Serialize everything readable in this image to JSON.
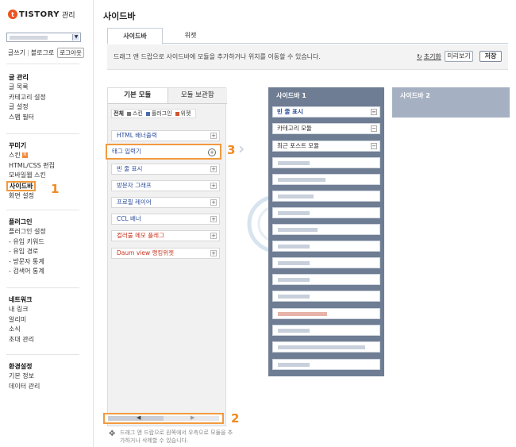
{
  "brand": {
    "logo": "TISTORY",
    "admin": "관리"
  },
  "quick_links": {
    "write": "글쓰기",
    "blog": "블로그로",
    "logout": "로그아웃"
  },
  "menu": {
    "post": {
      "title": "글 관리",
      "items": [
        "글 목록",
        "카테고리 설정",
        "글 설정",
        "스팸 필터"
      ]
    },
    "decorate": {
      "title": "꾸미기",
      "items": [
        "스킨",
        "HTML/CSS 편집",
        "모바일웹 스킨",
        "사이드바",
        "화면 설정"
      ],
      "new_badge": "N"
    },
    "plugin": {
      "title": "플러그인",
      "items": [
        "플러그인 설정",
        "- 유입 키워드",
        "- 유입 경로",
        "- 방문자 통계",
        "- 검색어 통계"
      ]
    },
    "network": {
      "title": "네트워크",
      "items": [
        "내 링크",
        "알리미",
        "소식",
        "초대 관리"
      ]
    },
    "settings": {
      "title": "환경설정",
      "items": [
        "기본 정보",
        "데이터 관리"
      ]
    }
  },
  "steps": {
    "one": "1",
    "two": "2",
    "three": "3"
  },
  "page": {
    "title": "사이드바",
    "tabs": [
      "사이드바",
      "위젯"
    ],
    "guide": "드래그 앤 드랍으로 사이드바에 모듈을 추가하거나 위치를 이동할 수 있습니다.",
    "reset": "초기화",
    "preview": "미리보기",
    "save": "저장"
  },
  "library": {
    "tabs": [
      "기본 모듈",
      "모듈 보관함"
    ],
    "filters": {
      "all": "전체",
      "skin": "스킨",
      "plugin": "플러그인",
      "widget": "위젯"
    },
    "items": [
      "HTML 배너출력",
      "태그 입력기",
      "빈 줄 표시",
      "방문자 그래프",
      "프로필 레이어",
      "CCL 배너",
      "컬러풀 메모 플레그",
      "Daum view 랭킹위젯"
    ],
    "hint": "드래그 앤 드랍으로 원쪽에서 우측으로 모듈을 추가하거나 삭제할 수 있습니다."
  },
  "sidebar1": {
    "title": "사이드바 1",
    "items": [
      "빈 줄 표시",
      "카테고리 모듈",
      "최근 포스트 모듈"
    ]
  },
  "sidebar2": {
    "title": "사이드바 2"
  },
  "colors": {
    "accent": "#f29a3e",
    "column": "#6e7d93",
    "column2": "#a5b1c2",
    "brand": "#eb531f",
    "link": "#2a4d9a"
  }
}
